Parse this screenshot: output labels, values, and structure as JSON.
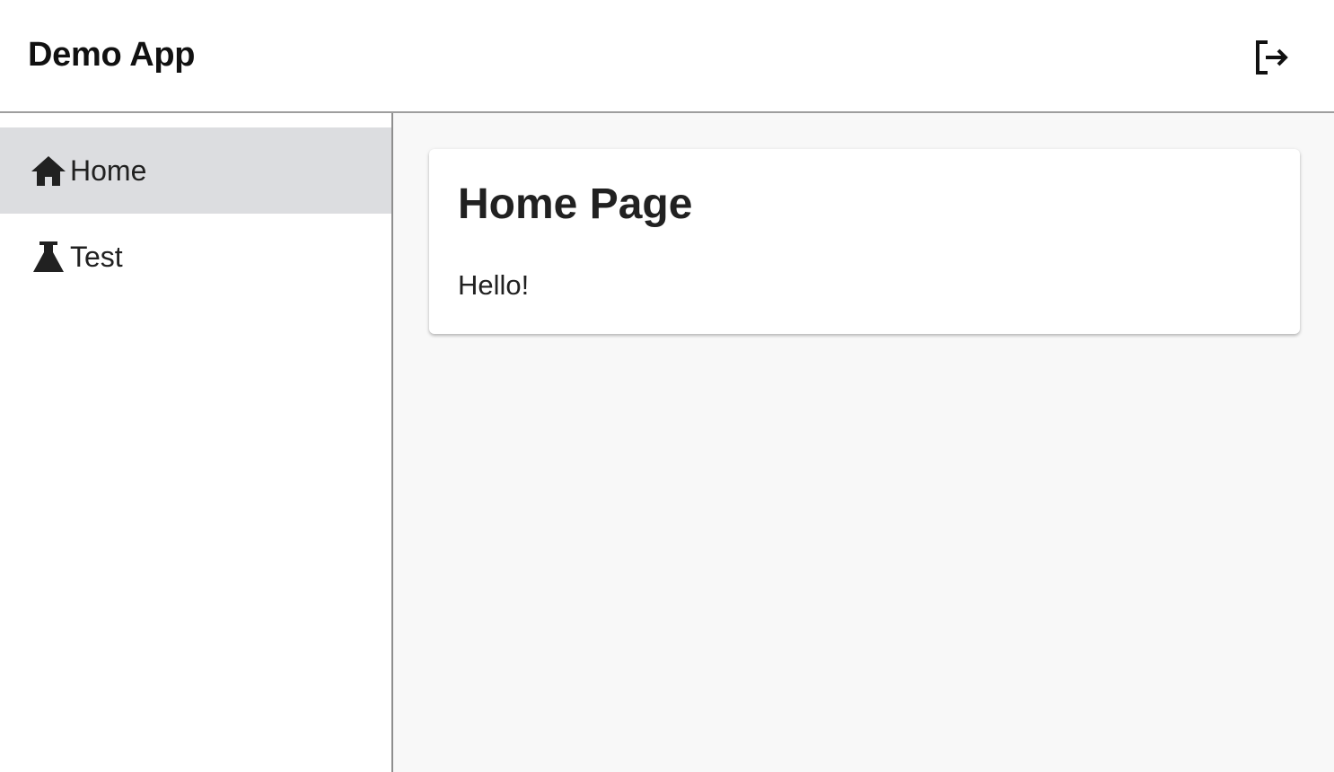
{
  "header": {
    "title": "Demo App",
    "logout_icon": "logout-icon"
  },
  "sidebar": {
    "items": [
      {
        "label": "Home",
        "icon": "home-icon",
        "active": true
      },
      {
        "label": "Test",
        "icon": "flask-icon",
        "active": false
      }
    ]
  },
  "main": {
    "card": {
      "title": "Home Page",
      "text": "Hello!"
    }
  },
  "colors": {
    "active_nav_bg": "#dcdde0",
    "main_bg": "#f8f8f8",
    "text": "#212121",
    "divider": "#9e9e9e"
  }
}
